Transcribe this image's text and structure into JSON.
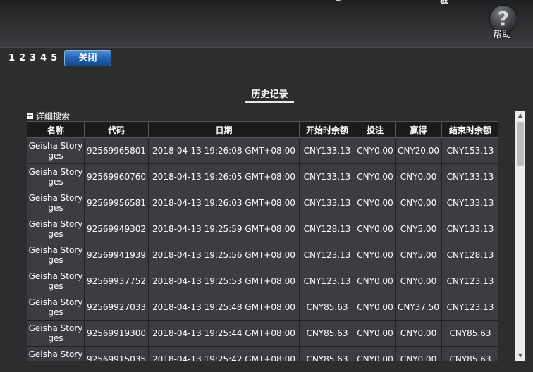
{
  "header": {
    "fragment_left": "£",
    "fragment_right": "板",
    "help_glyph": "?",
    "help_label": "帮助"
  },
  "pager": {
    "pages": [
      "1",
      "2",
      "3",
      "4",
      "5"
    ],
    "close_label": "关闭"
  },
  "tab": {
    "label": "历史记录"
  },
  "advanced_search": {
    "icon": "plus-icon",
    "label": "详细搜索"
  },
  "table": {
    "columns": [
      "名称",
      "代码",
      "日期",
      "开始时余额",
      "投注",
      "赢得",
      "结束时余额"
    ],
    "rows": [
      {
        "name_l1": "Geisha Story",
        "name_l2": "ges",
        "code": "92569965801",
        "date": "2018-04-13 19:26:08 GMT+08:00",
        "start": "CNY133.13",
        "bet": "CNY0.00",
        "win": "CNY20.00",
        "end": "CNY153.13"
      },
      {
        "name_l1": "Geisha Story",
        "name_l2": "ges",
        "code": "92569960760",
        "date": "2018-04-13 19:26:05 GMT+08:00",
        "start": "CNY133.13",
        "bet": "CNY0.00",
        "win": "CNY0.00",
        "end": "CNY133.13"
      },
      {
        "name_l1": "Geisha Story",
        "name_l2": "ges",
        "code": "92569956581",
        "date": "2018-04-13 19:26:03 GMT+08:00",
        "start": "CNY133.13",
        "bet": "CNY0.00",
        "win": "CNY0.00",
        "end": "CNY133.13"
      },
      {
        "name_l1": "Geisha Story",
        "name_l2": "ges",
        "code": "92569949302",
        "date": "2018-04-13 19:25:59 GMT+08:00",
        "start": "CNY128.13",
        "bet": "CNY0.00",
        "win": "CNY5.00",
        "end": "CNY133.13"
      },
      {
        "name_l1": "Geisha Story",
        "name_l2": "ges",
        "code": "92569941939",
        "date": "2018-04-13 19:25:56 GMT+08:00",
        "start": "CNY123.13",
        "bet": "CNY0.00",
        "win": "CNY5.00",
        "end": "CNY128.13"
      },
      {
        "name_l1": "Geisha Story",
        "name_l2": "ges",
        "code": "92569937752",
        "date": "2018-04-13 19:25:53 GMT+08:00",
        "start": "CNY123.13",
        "bet": "CNY0.00",
        "win": "CNY0.00",
        "end": "CNY123.13"
      },
      {
        "name_l1": "Geisha Story",
        "name_l2": "ges",
        "code": "92569927033",
        "date": "2018-04-13 19:25:48 GMT+08:00",
        "start": "CNY85.63",
        "bet": "CNY0.00",
        "win": "CNY37.50",
        "end": "CNY123.13"
      },
      {
        "name_l1": "Geisha Story",
        "name_l2": "ges",
        "code": "92569919300",
        "date": "2018-04-13 19:25:44 GMT+08:00",
        "start": "CNY85.63",
        "bet": "CNY0.00",
        "win": "CNY0.00",
        "end": "CNY85.63"
      },
      {
        "name_l1": "Geisha Story",
        "name_l2": "ges",
        "code": "92569915035",
        "date": "2018-04-13 19:25:42 GMT+08:00",
        "start": "CNY85.63",
        "bet": "CNY0.00",
        "win": "CNY0.00",
        "end": "CNY85.63"
      }
    ]
  },
  "scrollbar": {
    "up_icon": "arrow-up-icon",
    "down_icon": "arrow-down-icon"
  }
}
